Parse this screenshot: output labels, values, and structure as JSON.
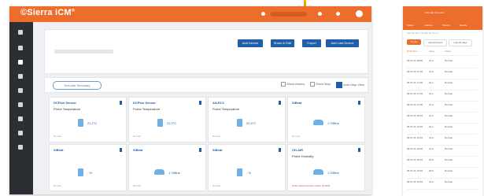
{
  "brand": {
    "logo_text": "©Sierra iCM°",
    "accent": "#ed6e2c",
    "primary": "#1f5fa9",
    "sidebar": "#2b2e33",
    "arrow_color": "#f2a100"
  },
  "topbar": {
    "user_label": "",
    "icons": [
      "bell-icon",
      "user-icon",
      "settings-icon"
    ]
  },
  "header": {
    "search_placeholder": "",
    "buttons": [
      {
        "label": "Add Device"
      },
      {
        "label": "Share & Edit"
      },
      {
        "label": "Export"
      },
      {
        "label": "Add Last Device"
      }
    ]
  },
  "section": {
    "tab_label": "Sub-site Summary",
    "options": [
      {
        "label": "Show Alarms",
        "checked": false
      },
      {
        "label": "Show Map",
        "checked": false
      },
      {
        "label": "Auto Map View",
        "checked": true
      }
    ]
  },
  "cards": [
    {
      "title": "DCPlus Sensor",
      "sub": "Probe Temperature",
      "value": "21.2°C",
      "icon": "thermometer-icon",
      "foot": "Normal",
      "alert": ""
    },
    {
      "title": "DCPlus Sensor",
      "sub": "Probe Temperature",
      "value": "22.0°C",
      "icon": "thermometer-icon",
      "foot": "Normal",
      "alert": ""
    },
    {
      "title": "AN-EC1",
      "sub": "Probe Temperature",
      "value": "20.4°C",
      "icon": "thermometer-icon",
      "foot": "Normal",
      "alert": ""
    },
    {
      "title": "SiBeat",
      "sub": "",
      "value": "1 Offline",
      "icon": "signal-icon",
      "foot": "Normal",
      "alert": ""
    },
    {
      "title": "SiBeat",
      "sub": "",
      "value": "- %",
      "icon": "battery-icon",
      "foot": "Normal",
      "alert": ""
    },
    {
      "title": "SiBeat",
      "sub": "",
      "value": "1 Offline",
      "icon": "signal-icon",
      "foot": "Normal",
      "alert": ""
    },
    {
      "title": "SiBeat",
      "sub": "",
      "value": "- %",
      "icon": "battery-icon",
      "foot": "Normal",
      "alert": ""
    },
    {
      "title": "CH-AIR",
      "sub": "Probe Humidity",
      "value": "1 Offline",
      "icon": "signal-icon",
      "foot": "",
      "alert": "Probe Disconnected / Alarm ID:1501"
    }
  ],
  "phone": {
    "title": "Sub-site Overview",
    "tabs": [
      "Status",
      "Alarms",
      "Trends",
      "Events"
    ],
    "filter_text": "Site ID: ALL ▾  Probe ID: ALL ▾",
    "chips": [
      {
        "label": "Trends",
        "active": true
      },
      {
        "label": "Last 24 hours",
        "active": false
      },
      {
        "label": "Last 30 days",
        "active": false
      }
    ],
    "columns": [
      "Date/Time",
      "Value",
      "Status"
    ],
    "rows": [
      {
        "time": "06.07.21 18:00",
        "val": "21.2",
        "status": "Normal"
      },
      {
        "time": "06.07.21 17:45",
        "val": "21.0",
        "status": "Normal"
      },
      {
        "time": "06.07.21 17:30",
        "val": "21.1",
        "status": "Normal"
      },
      {
        "time": "06.07.21 17:15",
        "val": "21.2",
        "status": "Normal"
      },
      {
        "time": "06.07.21 17:00",
        "val": "21.3",
        "status": "Normal"
      },
      {
        "time": "06.07.21 16:45",
        "val": "21.2",
        "status": "Normal"
      },
      {
        "time": "06.07.21 16:30",
        "val": "21.1",
        "status": "Normal"
      },
      {
        "time": "06.07.21 16:15",
        "val": "21.0",
        "status": "Normal"
      },
      {
        "time": "06.07.21 16:00",
        "val": "21.0",
        "status": "Normal"
      },
      {
        "time": "06.07.21 15:45",
        "val": "20.9",
        "status": "Normal"
      },
      {
        "time": "06.07.21 15:30",
        "val": "20.9",
        "status": "Normal"
      },
      {
        "time": "06.07.21 15:15",
        "val": "21.0",
        "status": "Normal"
      }
    ]
  }
}
